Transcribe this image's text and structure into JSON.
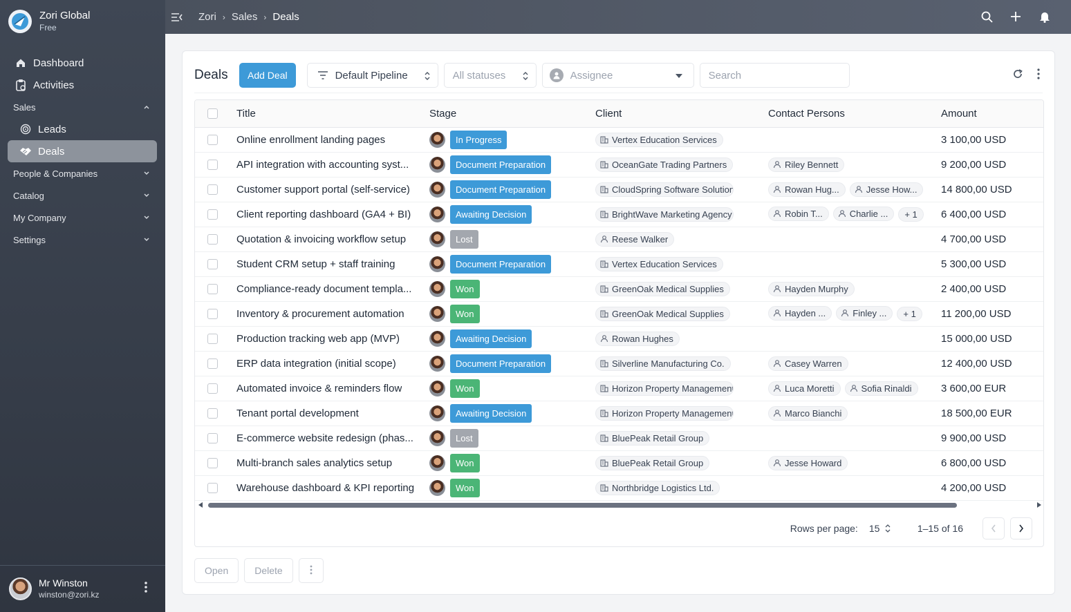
{
  "brand": {
    "name": "Zori Global",
    "plan": "Free"
  },
  "nav": {
    "dashboard": "Dashboard",
    "activities": "Activities",
    "sales": "Sales",
    "leads": "Leads",
    "deals": "Deals",
    "people": "People & Companies",
    "catalog": "Catalog",
    "company": "My Company",
    "settings": "Settings"
  },
  "user": {
    "name": "Mr Winston",
    "email": "winston@zori.kz"
  },
  "breadcrumb": [
    "Zori",
    "Sales",
    "Deals"
  ],
  "toolbar": {
    "title": "Deals",
    "add_label": "Add Deal",
    "pipeline": "Default Pipeline",
    "statuses": "All statuses",
    "assignee": "Assignee",
    "search_placeholder": "Search"
  },
  "columns": [
    "Title",
    "Stage",
    "Client",
    "Contact Persons",
    "Amount"
  ],
  "rows": [
    {
      "title": "Online enrollment landing pages",
      "stage": "In Progress",
      "stage_type": "progress",
      "client": "Vertex Education Services",
      "client_kind": "company",
      "contacts": [],
      "amount": "3 100,00 USD"
    },
    {
      "title": "API integration with accounting syst...",
      "stage": "Document Preparation",
      "stage_type": "doc",
      "client": "OceanGate Trading Partners",
      "client_kind": "company",
      "contacts": [
        "Riley Bennett"
      ],
      "amount": "9 200,00 USD"
    },
    {
      "title": "Customer support portal (self-service)",
      "stage": "Document Preparation",
      "stage_type": "doc",
      "client": "CloudSpring Software Solutions",
      "client_kind": "company",
      "contacts": [
        "Rowan Hug...",
        "Jesse How..."
      ],
      "amount": "14 800,00 USD"
    },
    {
      "title": "Client reporting dashboard (GA4 + BI)",
      "stage": "Awaiting Decision",
      "stage_type": "await",
      "client": "BrightWave Marketing Agency",
      "client_kind": "company",
      "contacts": [
        "Robin T...",
        "Charlie ..."
      ],
      "more": "+ 1",
      "amount": "6 400,00 USD"
    },
    {
      "title": "Quotation & invoicing workflow setup",
      "stage": "Lost",
      "stage_type": "lost",
      "client": "Reese Walker",
      "client_kind": "person",
      "contacts": [],
      "amount": "4 700,00 USD"
    },
    {
      "title": "Student CRM setup + staff training",
      "stage": "Document Preparation",
      "stage_type": "doc",
      "client": "Vertex Education Services",
      "client_kind": "company",
      "contacts": [],
      "amount": "5 300,00 USD"
    },
    {
      "title": "Compliance-ready document templa...",
      "stage": "Won",
      "stage_type": "won",
      "client": "GreenOak Medical Supplies",
      "client_kind": "company",
      "contacts": [
        "Hayden Murphy"
      ],
      "amount": "2 400,00 USD"
    },
    {
      "title": "Inventory & procurement automation",
      "stage": "Won",
      "stage_type": "won",
      "client": "GreenOak Medical Supplies",
      "client_kind": "company",
      "contacts": [
        "Hayden ...",
        "Finley ..."
      ],
      "more": "+ 1",
      "amount": "11 200,00 USD"
    },
    {
      "title": "Production tracking web app (MVP)",
      "stage": "Awaiting Decision",
      "stage_type": "await",
      "client": "Rowan Hughes",
      "client_kind": "person",
      "contacts": [],
      "amount": "15 000,00 USD"
    },
    {
      "title": "ERP data integration (initial scope)",
      "stage": "Document Preparation",
      "stage_type": "doc",
      "client": "Silverline Manufacturing Co.",
      "client_kind": "company",
      "contacts": [
        "Casey Warren"
      ],
      "amount": "12 400,00 USD"
    },
    {
      "title": "Automated invoice & reminders flow",
      "stage": "Won",
      "stage_type": "won",
      "client": "Horizon Property Management",
      "client_kind": "company",
      "contacts": [
        "Luca Moretti",
        "Sofia Rinaldi"
      ],
      "amount": "3 600,00 EUR"
    },
    {
      "title": "Tenant portal development",
      "stage": "Awaiting Decision",
      "stage_type": "await",
      "client": "Horizon Property Management",
      "client_kind": "company",
      "contacts": [
        "Marco Bianchi"
      ],
      "amount": "18 500,00 EUR"
    },
    {
      "title": "E-commerce website redesign (phas...",
      "stage": "Lost",
      "stage_type": "lost",
      "client": "BluePeak Retail Group",
      "client_kind": "company",
      "contacts": [],
      "amount": "9 900,00 USD"
    },
    {
      "title": "Multi-branch sales analytics setup",
      "stage": "Won",
      "stage_type": "won",
      "client": "BluePeak Retail Group",
      "client_kind": "company",
      "contacts": [
        "Jesse Howard"
      ],
      "amount": "6 800,00 USD"
    },
    {
      "title": "Warehouse dashboard & KPI reporting",
      "stage": "Won",
      "stage_type": "won",
      "client": "Northbridge Logistics Ltd.",
      "client_kind": "company",
      "contacts": [],
      "amount": "4 200,00 USD"
    }
  ],
  "pagination": {
    "rows_per_page_label": "Rows per page:",
    "rows_per_page": "15",
    "range": "1–15 of 16"
  },
  "footer": {
    "open": "Open",
    "delete": "Delete"
  },
  "colors": {
    "accent": "#3d9ad8",
    "won": "#4bb576",
    "lost": "#a3a7ae"
  }
}
